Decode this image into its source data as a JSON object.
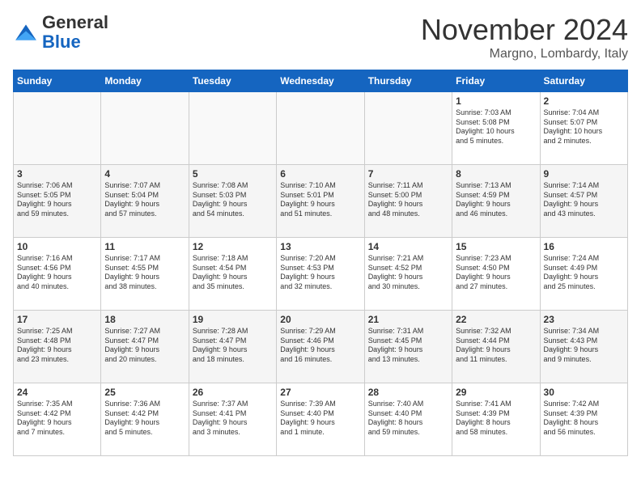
{
  "header": {
    "logo_general": "General",
    "logo_blue": "Blue",
    "month_title": "November 2024",
    "location": "Margno, Lombardy, Italy"
  },
  "days_of_week": [
    "Sunday",
    "Monday",
    "Tuesday",
    "Wednesday",
    "Thursday",
    "Friday",
    "Saturday"
  ],
  "weeks": [
    [
      {
        "day": "",
        "info": ""
      },
      {
        "day": "",
        "info": ""
      },
      {
        "day": "",
        "info": ""
      },
      {
        "day": "",
        "info": ""
      },
      {
        "day": "",
        "info": ""
      },
      {
        "day": "1",
        "info": "Sunrise: 7:03 AM\nSunset: 5:08 PM\nDaylight: 10 hours\nand 5 minutes."
      },
      {
        "day": "2",
        "info": "Sunrise: 7:04 AM\nSunset: 5:07 PM\nDaylight: 10 hours\nand 2 minutes."
      }
    ],
    [
      {
        "day": "3",
        "info": "Sunrise: 7:06 AM\nSunset: 5:05 PM\nDaylight: 9 hours\nand 59 minutes."
      },
      {
        "day": "4",
        "info": "Sunrise: 7:07 AM\nSunset: 5:04 PM\nDaylight: 9 hours\nand 57 minutes."
      },
      {
        "day": "5",
        "info": "Sunrise: 7:08 AM\nSunset: 5:03 PM\nDaylight: 9 hours\nand 54 minutes."
      },
      {
        "day": "6",
        "info": "Sunrise: 7:10 AM\nSunset: 5:01 PM\nDaylight: 9 hours\nand 51 minutes."
      },
      {
        "day": "7",
        "info": "Sunrise: 7:11 AM\nSunset: 5:00 PM\nDaylight: 9 hours\nand 48 minutes."
      },
      {
        "day": "8",
        "info": "Sunrise: 7:13 AM\nSunset: 4:59 PM\nDaylight: 9 hours\nand 46 minutes."
      },
      {
        "day": "9",
        "info": "Sunrise: 7:14 AM\nSunset: 4:57 PM\nDaylight: 9 hours\nand 43 minutes."
      }
    ],
    [
      {
        "day": "10",
        "info": "Sunrise: 7:16 AM\nSunset: 4:56 PM\nDaylight: 9 hours\nand 40 minutes."
      },
      {
        "day": "11",
        "info": "Sunrise: 7:17 AM\nSunset: 4:55 PM\nDaylight: 9 hours\nand 38 minutes."
      },
      {
        "day": "12",
        "info": "Sunrise: 7:18 AM\nSunset: 4:54 PM\nDaylight: 9 hours\nand 35 minutes."
      },
      {
        "day": "13",
        "info": "Sunrise: 7:20 AM\nSunset: 4:53 PM\nDaylight: 9 hours\nand 32 minutes."
      },
      {
        "day": "14",
        "info": "Sunrise: 7:21 AM\nSunset: 4:52 PM\nDaylight: 9 hours\nand 30 minutes."
      },
      {
        "day": "15",
        "info": "Sunrise: 7:23 AM\nSunset: 4:50 PM\nDaylight: 9 hours\nand 27 minutes."
      },
      {
        "day": "16",
        "info": "Sunrise: 7:24 AM\nSunset: 4:49 PM\nDaylight: 9 hours\nand 25 minutes."
      }
    ],
    [
      {
        "day": "17",
        "info": "Sunrise: 7:25 AM\nSunset: 4:48 PM\nDaylight: 9 hours\nand 23 minutes."
      },
      {
        "day": "18",
        "info": "Sunrise: 7:27 AM\nSunset: 4:47 PM\nDaylight: 9 hours\nand 20 minutes."
      },
      {
        "day": "19",
        "info": "Sunrise: 7:28 AM\nSunset: 4:47 PM\nDaylight: 9 hours\nand 18 minutes."
      },
      {
        "day": "20",
        "info": "Sunrise: 7:29 AM\nSunset: 4:46 PM\nDaylight: 9 hours\nand 16 minutes."
      },
      {
        "day": "21",
        "info": "Sunrise: 7:31 AM\nSunset: 4:45 PM\nDaylight: 9 hours\nand 13 minutes."
      },
      {
        "day": "22",
        "info": "Sunrise: 7:32 AM\nSunset: 4:44 PM\nDaylight: 9 hours\nand 11 minutes."
      },
      {
        "day": "23",
        "info": "Sunrise: 7:34 AM\nSunset: 4:43 PM\nDaylight: 9 hours\nand 9 minutes."
      }
    ],
    [
      {
        "day": "24",
        "info": "Sunrise: 7:35 AM\nSunset: 4:42 PM\nDaylight: 9 hours\nand 7 minutes."
      },
      {
        "day": "25",
        "info": "Sunrise: 7:36 AM\nSunset: 4:42 PM\nDaylight: 9 hours\nand 5 minutes."
      },
      {
        "day": "26",
        "info": "Sunrise: 7:37 AM\nSunset: 4:41 PM\nDaylight: 9 hours\nand 3 minutes."
      },
      {
        "day": "27",
        "info": "Sunrise: 7:39 AM\nSunset: 4:40 PM\nDaylight: 9 hours\nand 1 minute."
      },
      {
        "day": "28",
        "info": "Sunrise: 7:40 AM\nSunset: 4:40 PM\nDaylight: 8 hours\nand 59 minutes."
      },
      {
        "day": "29",
        "info": "Sunrise: 7:41 AM\nSunset: 4:39 PM\nDaylight: 8 hours\nand 58 minutes."
      },
      {
        "day": "30",
        "info": "Sunrise: 7:42 AM\nSunset: 4:39 PM\nDaylight: 8 hours\nand 56 minutes."
      }
    ]
  ]
}
